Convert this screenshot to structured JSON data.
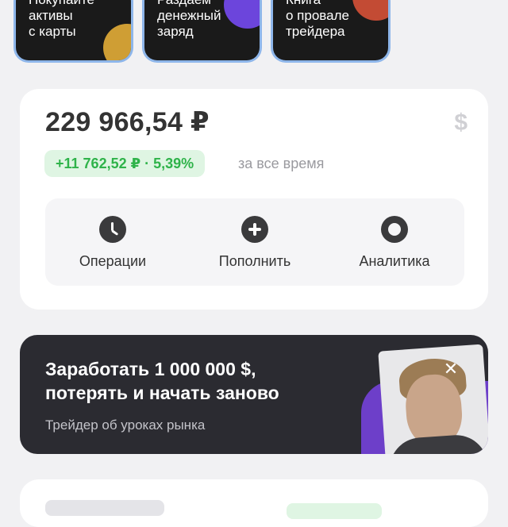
{
  "stories": [
    {
      "text": "Покупайте\nактивы\nс карты",
      "accent": "#f0b63a"
    },
    {
      "text": "Раздаем\nденежный\nзаряд",
      "accent": "#7b4dff"
    },
    {
      "text": "Книга\nо провале\nтрейдера",
      "accent": "#e2553a"
    }
  ],
  "portfolio": {
    "total": "229 966,54 ₽",
    "currency_icon": "$",
    "gain": "+11 762,52 ₽ · 5,39%",
    "period": "за все время",
    "actions": [
      {
        "label": "Операции",
        "icon": "clock-icon"
      },
      {
        "label": "Пополнить",
        "icon": "plus-icon"
      },
      {
        "label": "Аналитика",
        "icon": "donut-chart-icon"
      }
    ]
  },
  "promo": {
    "title": "Заработать 1 000 000 $,\nпотерять и начать заново",
    "subtitle": "Трейдер об уроках рынка",
    "close": "✕"
  },
  "colors": {
    "gain_green": "#2fb34a",
    "gain_bg": "#dff5e3",
    "promo_bg": "#2b2b31",
    "promo_accent": "#6d3fc9"
  }
}
